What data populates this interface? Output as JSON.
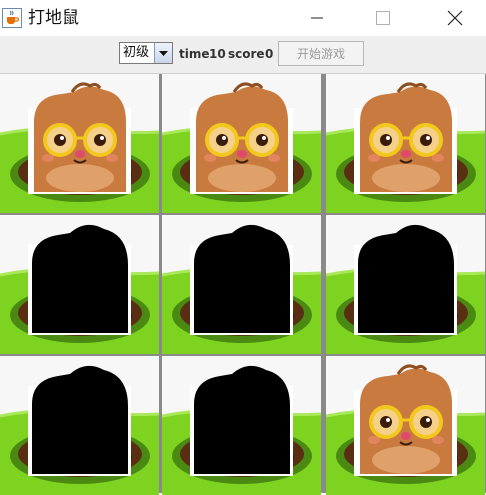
{
  "window": {
    "title": "打地鼠",
    "app_icon": "java-cup-icon",
    "controls": [
      "minimize-icon",
      "maximize-icon",
      "close-icon"
    ]
  },
  "toolbar": {
    "level_selected": "初级",
    "time_label": "time",
    "time_value": "10",
    "score_label": "score",
    "score_value": "0",
    "start_button": "开始游戏"
  },
  "board": {
    "rows": 3,
    "cols": 3,
    "cells": [
      "mole",
      "mole",
      "mole",
      "hidden",
      "hidden",
      "hidden",
      "hidden",
      "hidden",
      "mole"
    ]
  },
  "colors": {
    "grass": "#7ed321",
    "mole_body": "#c97a3f",
    "glasses": "#f2c81c",
    "hole": "#5a2e12",
    "shadow": "#000000"
  }
}
